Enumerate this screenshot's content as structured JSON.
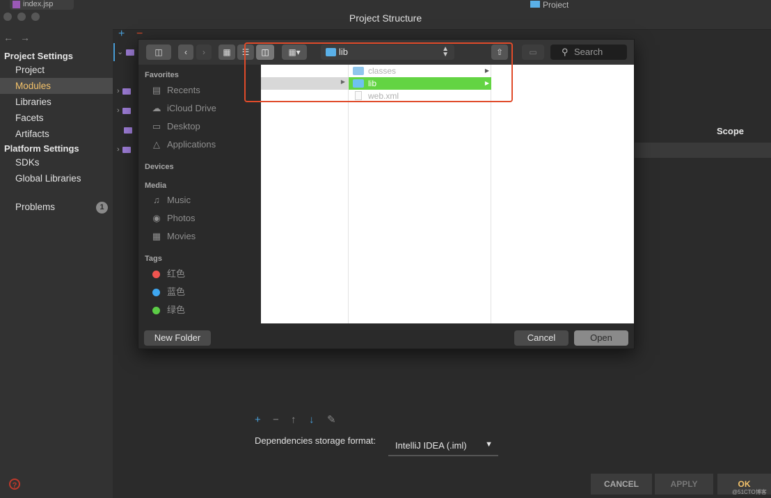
{
  "window": {
    "title": "Project Structure",
    "background_tab": "index.jsp",
    "background_project": "Project"
  },
  "sidebar": {
    "project_settings_header": "Project Settings",
    "project_items": [
      {
        "label": "Project",
        "selected": false
      },
      {
        "label": "Modules",
        "selected": true
      },
      {
        "label": "Libraries",
        "selected": false
      },
      {
        "label": "Facets",
        "selected": false
      },
      {
        "label": "Artifacts",
        "selected": false
      }
    ],
    "platform_settings_header": "Platform Settings",
    "platform_items": [
      {
        "label": "SDKs"
      },
      {
        "label": "Global Libraries"
      }
    ],
    "problems": {
      "label": "Problems",
      "count": "1"
    }
  },
  "right_panel": {
    "scope_header": "Scope",
    "deps_label": "Dependencies storage format:",
    "deps_value": "IntelliJ IDEA (.iml)"
  },
  "bottom_buttons": {
    "cancel": "CANCEL",
    "apply": "APPLY",
    "ok": "OK"
  },
  "file_dialog": {
    "path": "lib",
    "search_placeholder": "Search",
    "favorites_header": "Favorites",
    "favorites": [
      {
        "label": "Recents",
        "icon": "recents-icon"
      },
      {
        "label": "iCloud Drive",
        "icon": "cloud-icon"
      },
      {
        "label": "Desktop",
        "icon": "desktop-icon"
      },
      {
        "label": "Applications",
        "icon": "applications-icon"
      }
    ],
    "devices_header": "Devices",
    "media_header": "Media",
    "media": [
      {
        "label": "Music",
        "icon": "music-icon"
      },
      {
        "label": "Photos",
        "icon": "camera-icon"
      },
      {
        "label": "Movies",
        "icon": "film-icon"
      }
    ],
    "tags_header": "Tags",
    "tags": [
      {
        "label": "红色",
        "color": "#f0544f"
      },
      {
        "label": "蓝色",
        "color": "#3ea6f0"
      },
      {
        "label": "绿色",
        "color": "#5ccc46"
      }
    ],
    "files": [
      {
        "name": "classes",
        "type": "folder",
        "selected": false
      },
      {
        "name": "lib",
        "type": "folder",
        "selected": true
      },
      {
        "name": "web.xml",
        "type": "file",
        "selected": false
      }
    ],
    "new_folder": "New Folder",
    "cancel": "Cancel",
    "open": "Open"
  },
  "watermark": "@51CTO博客"
}
